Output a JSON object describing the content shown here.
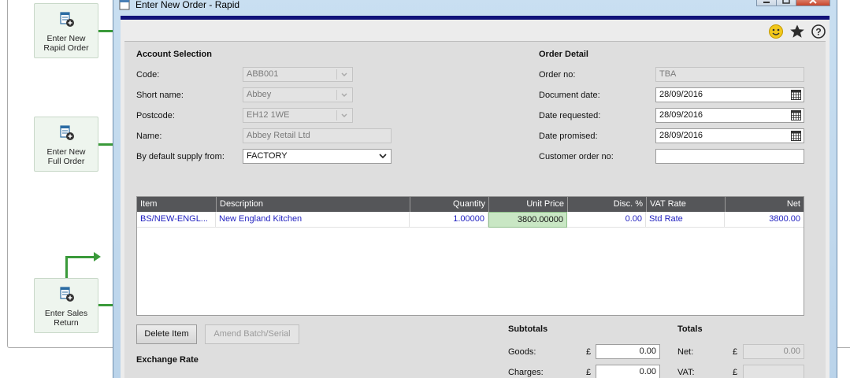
{
  "workflow": {
    "nodes": [
      {
        "label_line1": "Enter New",
        "label_line2": "Rapid Order",
        "icon": "order-form-add-icon"
      },
      {
        "label_line1": "Enter New",
        "label_line2": "Full Order",
        "icon": "order-form-add-icon"
      },
      {
        "label_line1": "Enter Sales",
        "label_line2": "Return",
        "icon": "order-form-add-icon"
      }
    ]
  },
  "window": {
    "title": "Enter New Order - Rapid",
    "icons": [
      "smiley-icon",
      "star-icon",
      "help-icon"
    ]
  },
  "account_selection": {
    "heading": "Account Selection",
    "code": {
      "label": "Code:",
      "value": "ABB001"
    },
    "short_name": {
      "label": "Short name:",
      "value": "Abbey"
    },
    "postcode": {
      "label": "Postcode:",
      "value": "EH12 1WE"
    },
    "name": {
      "label": "Name:",
      "value": "Abbey Retail Ltd"
    },
    "supply_from": {
      "label": "By default supply from:",
      "value": "FACTORY"
    }
  },
  "order_detail": {
    "heading": "Order Detail",
    "order_no": {
      "label": "Order no:",
      "value": "TBA"
    },
    "document_date": {
      "label": "Document date:",
      "value": "28/09/2016"
    },
    "date_requested": {
      "label": "Date requested:",
      "value": "28/09/2016"
    },
    "date_promised": {
      "label": "Date promised:",
      "value": "28/09/2016"
    },
    "customer_order_no": {
      "label": "Customer order no:",
      "value": ""
    }
  },
  "grid": {
    "columns": [
      "Item",
      "Description",
      "Quantity",
      "Unit Price",
      "Disc. %",
      "VAT Rate",
      "Net"
    ],
    "rows": [
      {
        "item": "BS/NEW-ENGL...",
        "description": "New England Kitchen",
        "quantity": "1.00000",
        "unit_price": "3800.00000",
        "disc": "0.00",
        "vat_rate": "Std Rate",
        "net": "3800.00"
      }
    ]
  },
  "buttons": {
    "delete_item": "Delete Item",
    "amend_batch": "Amend Batch/Serial"
  },
  "exchange_rate": {
    "heading": "Exchange Rate"
  },
  "subtotals": {
    "heading": "Subtotals",
    "goods": {
      "label": "Goods:",
      "currency": "£",
      "value": "0.00"
    },
    "charges": {
      "label": "Charges:",
      "currency": "£",
      "value": "0.00"
    }
  },
  "totals": {
    "heading": "Totals",
    "net": {
      "label": "Net:",
      "currency": "£",
      "value": "0.00"
    },
    "vat": {
      "label": "VAT:",
      "currency": "£",
      "value": ""
    }
  }
}
